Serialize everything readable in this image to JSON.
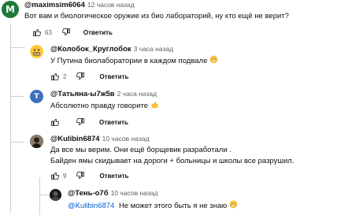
{
  "comments": [
    {
      "author": "@maximsim6064",
      "time": "12 часов назад",
      "text": "Вот вам и биологическое оружие из био лабораторий, ну кто ещё не верит?",
      "likes": "63",
      "reply_label": "Ответить",
      "avatar_letter": "M",
      "avatar_color": "#1f7a3a"
    },
    {
      "author": "@Колобок_Круглобок",
      "time": "3 часа назад",
      "text": "У Путина биолаборатории в каждом подвале",
      "likes": "2",
      "reply_label": "Ответить",
      "avatar_icon": "grimace-emoji-icon",
      "emoji_icon": "grinning-face-sweat-icon"
    },
    {
      "author": "@Татьяна-ы7ж5в",
      "time": "2 часа назад",
      "text": "Абсолютно правду говорите",
      "likes": "",
      "reply_label": "Ответить",
      "avatar_letter": "T",
      "avatar_color": "#3d6fbf",
      "emoji_icon": "thumbs-up-icon"
    },
    {
      "author": "@Kulibin6874",
      "time": "10 часов назад",
      "text_line1": "Да все мы верим. Они ещё борщевик разработали .",
      "text_line2": "Байден ямы скидывает на дороги + больницы и школы все разрушил.",
      "likes": "9",
      "reply_label": "Ответить",
      "avatar_icon": "user-photo-icon"
    },
    {
      "author": "@Тень-о7б",
      "time": "10 часов назад",
      "mention": "@Kulibin6874",
      "text": "Не может этого быть я не знаю",
      "avatar_icon": "user-photo-icon",
      "emoji_icon": "grinning-face-sweat-icon"
    }
  ]
}
